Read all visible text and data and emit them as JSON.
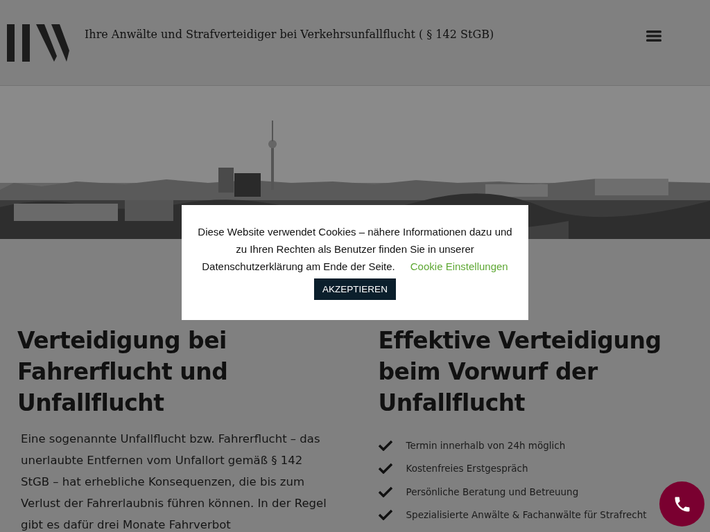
{
  "header": {
    "title": "Ihre Anwälte und Strafverteidiger bei Verkehrsunfallflucht ( § 142 StGB)"
  },
  "left": {
    "heading": "Verteidigung bei Fahrerflucht und Unfallflucht",
    "paragraph": "Eine sogenannte Unfallflucht bzw. Fahrerflucht – das unerlaubte Entfernen vom Unfallort gemäß § 142 StGB – hat erhebliche Konsequenzen, die bis zum Verlust der Fahrerlaubnis führen können. In der Regel gibt es dafür drei Monate Fahrverbot"
  },
  "right": {
    "heading": "Effektive Verteidigung beim Vorwurf der Unfallflucht",
    "checklist": [
      {
        "text": "Termin innerhalb von 24h möglich"
      },
      {
        "text": "Kostenfreies Erstgespräch"
      },
      {
        "text": "Persönliche Beratung und Betreuung"
      },
      {
        "text": "Spezialisierte Anwälte & Fachanwälte für Strafrecht"
      }
    ]
  },
  "cookie_banner": {
    "message": "Diese Website verwendet Cookies – nähere Informationen dazu und zu Ihren Rechten als Benutzer finden Sie in unserer Datenschutzerklärung am Ende der Seite.",
    "settings_link": "Cookie Einstellungen",
    "accept_button": "AKZEPTIEREN"
  }
}
